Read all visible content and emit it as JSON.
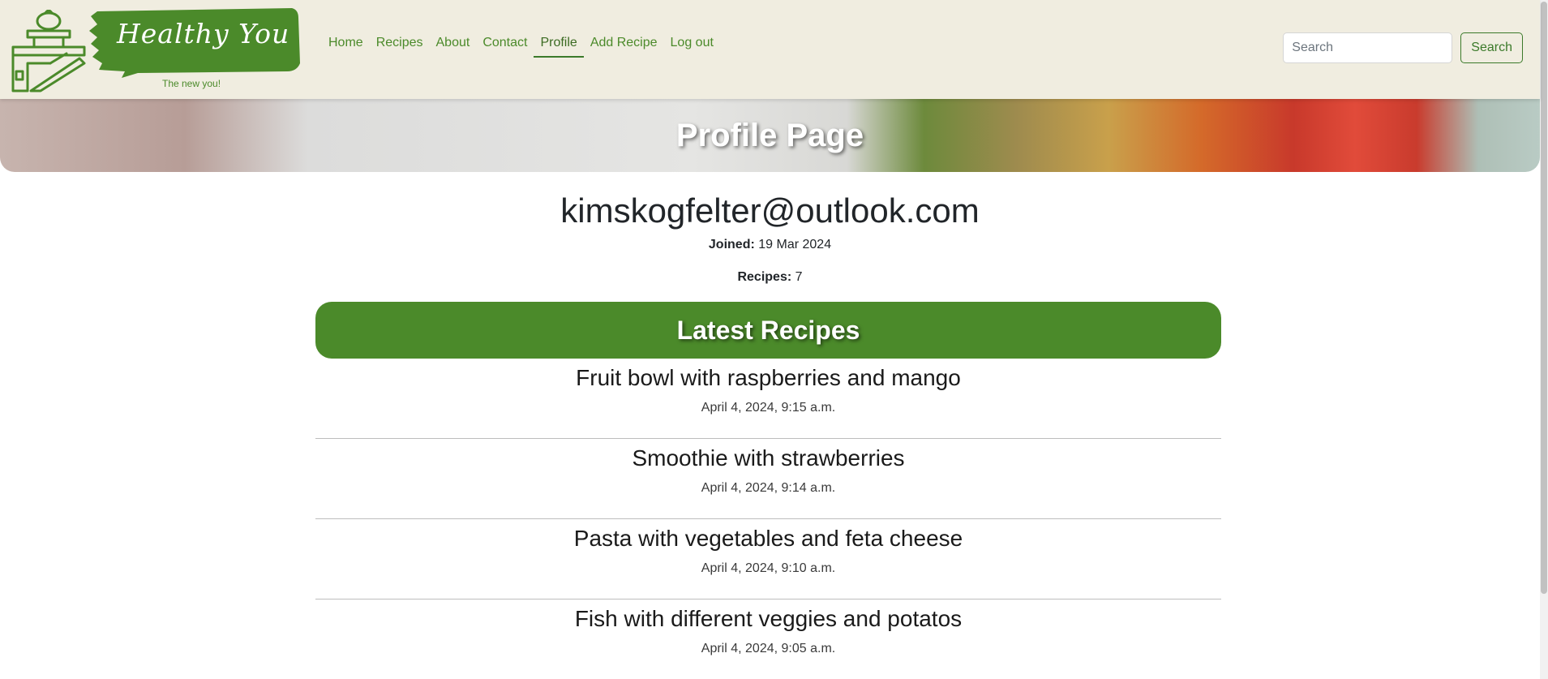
{
  "brand": {
    "title": "Healthy You",
    "tagline": "The new you!",
    "color": "#4b8a2a"
  },
  "nav": {
    "items": [
      {
        "label": "Home",
        "active": false
      },
      {
        "label": "Recipes",
        "active": false
      },
      {
        "label": "About",
        "active": false
      },
      {
        "label": "Contact",
        "active": false
      },
      {
        "label": "Profile",
        "active": true
      },
      {
        "label": "Add Recipe",
        "active": false
      },
      {
        "label": "Log out",
        "active": false
      }
    ]
  },
  "search": {
    "placeholder": "Search",
    "button_label": "Search"
  },
  "hero": {
    "title": "Profile Page"
  },
  "profile": {
    "email": "kimskogfelter@outlook.com",
    "joined_label": "Joined:",
    "joined_value": "19 Mar 2024",
    "recipes_label": "Recipes:",
    "recipes_value": "7"
  },
  "latest": {
    "heading": "Latest Recipes",
    "items": [
      {
        "title": "Fruit bowl with raspberries and mango",
        "date": "April 4, 2024, 9:15 a.m."
      },
      {
        "title": "Smoothie with strawberries",
        "date": "April 4, 2024, 9:14 a.m."
      },
      {
        "title": "Pasta with vegetables and feta cheese",
        "date": "April 4, 2024, 9:10 a.m."
      },
      {
        "title": "Fish with different veggies and potatos",
        "date": "April 4, 2024, 9:05 a.m."
      }
    ]
  }
}
